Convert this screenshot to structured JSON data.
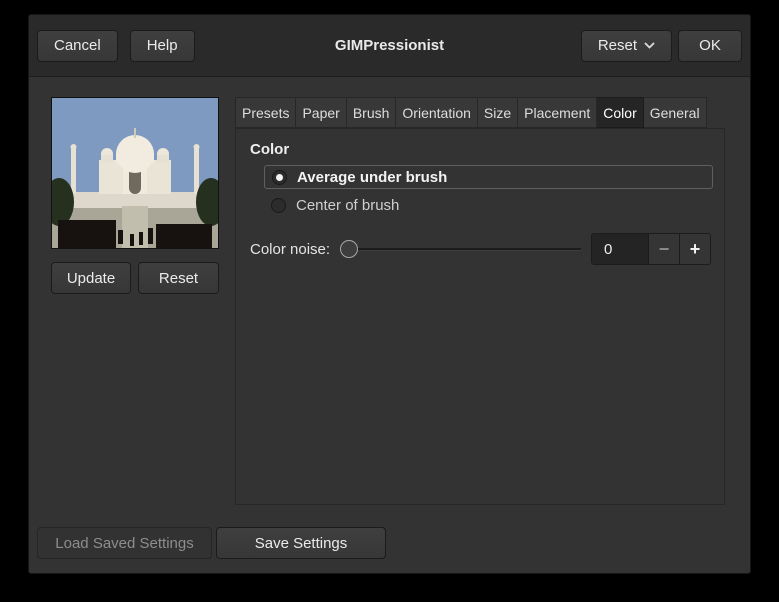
{
  "dialog": {
    "title": "GIMPressionist",
    "header": {
      "cancel_label": "Cancel",
      "help_label": "Help",
      "reset_label": "Reset",
      "ok_label": "OK"
    },
    "preview": {
      "update_label": "Update",
      "reset_label": "Reset"
    },
    "tabs": [
      {
        "label": "Presets"
      },
      {
        "label": "Paper"
      },
      {
        "label": "Brush"
      },
      {
        "label": "Orientation"
      },
      {
        "label": "Size"
      },
      {
        "label": "Placement"
      },
      {
        "label": "Color",
        "active": true
      },
      {
        "label": "General"
      }
    ],
    "color_panel": {
      "section_title": "Color",
      "options": [
        {
          "label": "Average under brush",
          "selected": true
        },
        {
          "label": "Center of brush",
          "selected": false
        }
      ],
      "noise_label": "Color noise:",
      "noise_value": "0",
      "decrement_label": "−",
      "increment_label": "+"
    },
    "footer": {
      "load_label": "Load Saved Settings",
      "save_label": "Save Settings"
    }
  },
  "colors": {
    "window_border": "#000000",
    "dialog_bg": "#333333",
    "header_bg": "#2a2a2a",
    "active_tab_bg": "#252525",
    "selected_frame": "#5f5f5f",
    "disabled_text": "#8d8d8d"
  }
}
